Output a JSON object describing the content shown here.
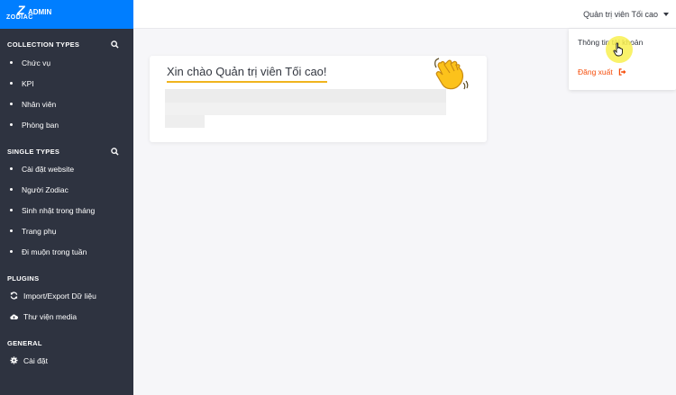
{
  "logo": {
    "letter": "Z",
    "brand": "ZODIAC",
    "admin": "ADMIN"
  },
  "sections": {
    "collection_types": {
      "title": "COLLECTION TYPES",
      "items": [
        "Chức vụ",
        "KPI",
        "Nhân viên",
        "Phòng ban"
      ]
    },
    "single_types": {
      "title": "SINGLE TYPES",
      "items": [
        "Cài đặt website",
        "Người Zodiac",
        "Sinh nhật trong tháng",
        "Trang phụ",
        "Đi muộn trong tuần"
      ]
    },
    "plugins": {
      "title": "PLUGINS",
      "items": [
        {
          "label": "Import/Export Dữ liệu",
          "icon": "sync-icon"
        },
        {
          "label": "Thư viện media",
          "icon": "cloud-upload-icon"
        }
      ]
    },
    "general": {
      "title": "GENERAL",
      "items": [
        {
          "label": "Cài đặt",
          "icon": "gear-icon"
        }
      ]
    }
  },
  "topbar": {
    "user_name": "Quản trị viên Tối cao"
  },
  "dropdown": {
    "account": "Thông tin tài khoản",
    "logout": "Đăng xuất"
  },
  "welcome": {
    "title": "Xin chào Quản trị viên Tối cao!",
    "icon": "waving-hand-icon"
  },
  "colors": {
    "sidebar_bg": "#2e3340",
    "brand_blue": "#007eff",
    "logout_orange": "#f64d0a",
    "underline_yellow": "#f0b41e"
  }
}
